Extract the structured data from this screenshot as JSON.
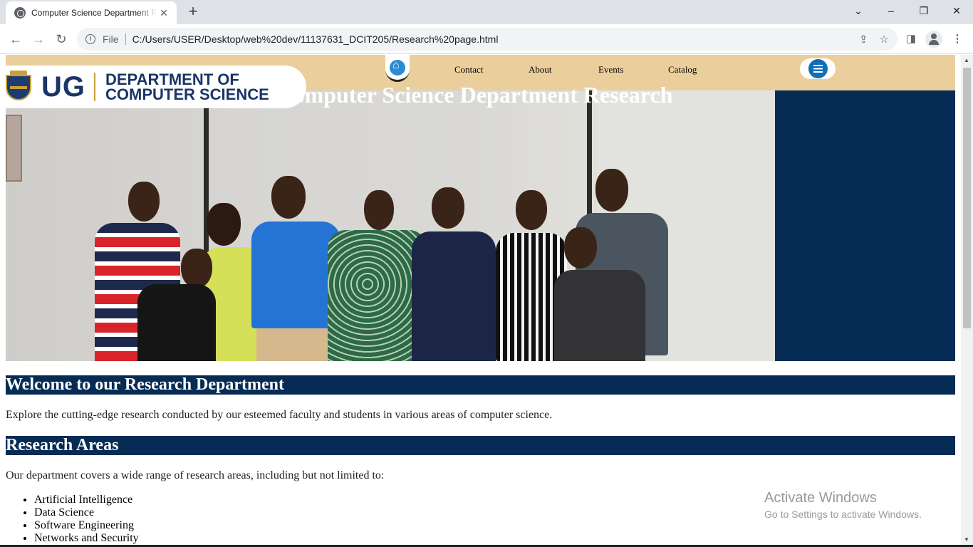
{
  "browser": {
    "tab_title": "Computer Science Department Research",
    "new_tab_label": "+",
    "url_scheme_label": "File",
    "url": "C:/Users/USER/Desktop/web%20dev/11137631_DCIT205/Research%20page.html",
    "icons": {
      "tab_favicon": "globe-icon",
      "tab_close": "close-icon",
      "back": "arrow-left-icon",
      "forward": "arrow-right-icon",
      "reload": "reload-icon",
      "site_info": "info-icon",
      "share": "share-icon",
      "bookmark": "star-icon",
      "side_panel": "side-panel-icon",
      "profile": "profile-icon",
      "menu": "kebab-menu-icon",
      "tab_search": "chevron-down-icon",
      "minimize": "minimize-icon",
      "restore": "restore-icon",
      "close_window": "close-icon"
    }
  },
  "site": {
    "logo_short": "UG",
    "logo_line1": "DEPARTMENT OF",
    "logo_line2": "COMPUTER SCIENCE",
    "nav": [
      "Contact",
      "About",
      "Events",
      "Catalog"
    ],
    "home_icon": "home-icon",
    "menu_icon": "list-menu-icon",
    "hero_title": "Computer Science Department Research",
    "welcome_heading": "Welcome to our Research Department",
    "welcome_text": "Explore the cutting-edge research conducted by our esteemed faculty and students in various areas of computer science.",
    "areas_heading": "Research Areas",
    "areas_intro": "Our department covers a wide range of research areas, including but not limited to:",
    "areas": [
      "Artificial Intelligence",
      "Data Science",
      "Software Engineering",
      "Networks and Security"
    ]
  },
  "overlay": {
    "watermark_title": "Activate Windows",
    "watermark_sub": "Go to Settings to activate Windows."
  },
  "colors": {
    "nav_bg": "#eacf9c",
    "heading_bg": "#062c55",
    "brand_blue": "#1a3566",
    "brand_gold": "#c9a13b"
  }
}
